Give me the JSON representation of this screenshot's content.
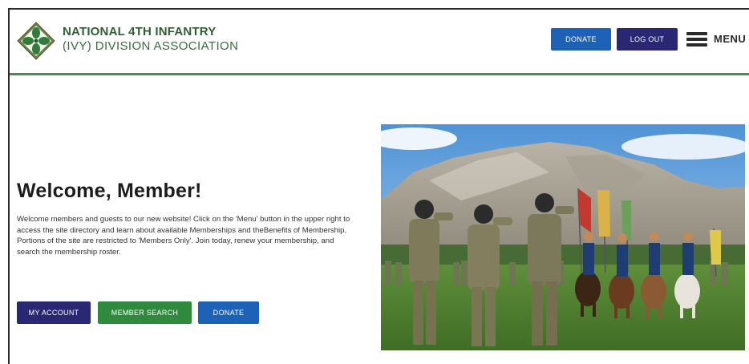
{
  "header": {
    "org_line1": "NATIONAL 4TH INFANTRY",
    "org_line2": "(IVY) DIVISION ASSOCIATION",
    "donate_label": "DONATE",
    "logout_label": "LOG OUT",
    "menu_label": "MENU"
  },
  "main": {
    "title": "Welcome, Member!",
    "body": "Welcome members and guests to our new website! Click on the 'Menu' button in the upper right to access the site directory and learn about available Memberships and theBenefits of Membership. Portions of the site are restricted to 'Members Only'. Join today, renew your membership, and search the membership roster.",
    "buttons": {
      "account": "MY ACCOUNT",
      "search": "MEMBER SEARCH",
      "donate": "DONATE"
    }
  },
  "colors": {
    "brand_green": "#2f5e34",
    "rule_green": "#4f8a55",
    "donate_blue": "#1d62b6",
    "navy": "#2b2873",
    "search_green": "#2f8a3e"
  },
  "icons": {
    "logo": "ivy-leaf-logo",
    "menu": "hamburger-menu-icon"
  }
}
